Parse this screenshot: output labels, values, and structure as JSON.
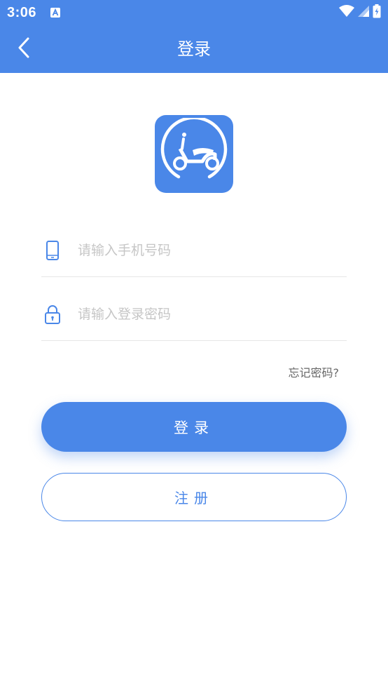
{
  "status_bar": {
    "time": "3:06",
    "notification_icon": "a-letter-icon",
    "icons": [
      "wifi-icon",
      "signal-icon",
      "battery-charging-icon"
    ]
  },
  "nav": {
    "back_icon": "chevron-left-icon",
    "title": "登录"
  },
  "logo": {
    "icon": "scooter-icon"
  },
  "form": {
    "phone_placeholder": "请输入手机号码",
    "phone_value": "",
    "password_placeholder": "请输入登录密码",
    "password_value": "",
    "phone_icon": "phone-icon",
    "password_icon": "lock-icon"
  },
  "forgot_label": "忘记密码?",
  "login_label": "登录",
  "register_label": "注册",
  "colors": {
    "primary": "#4a87e8",
    "placeholder": "#c6c6c6",
    "divider": "#e6e6e6",
    "secondary_text": "#666666"
  }
}
